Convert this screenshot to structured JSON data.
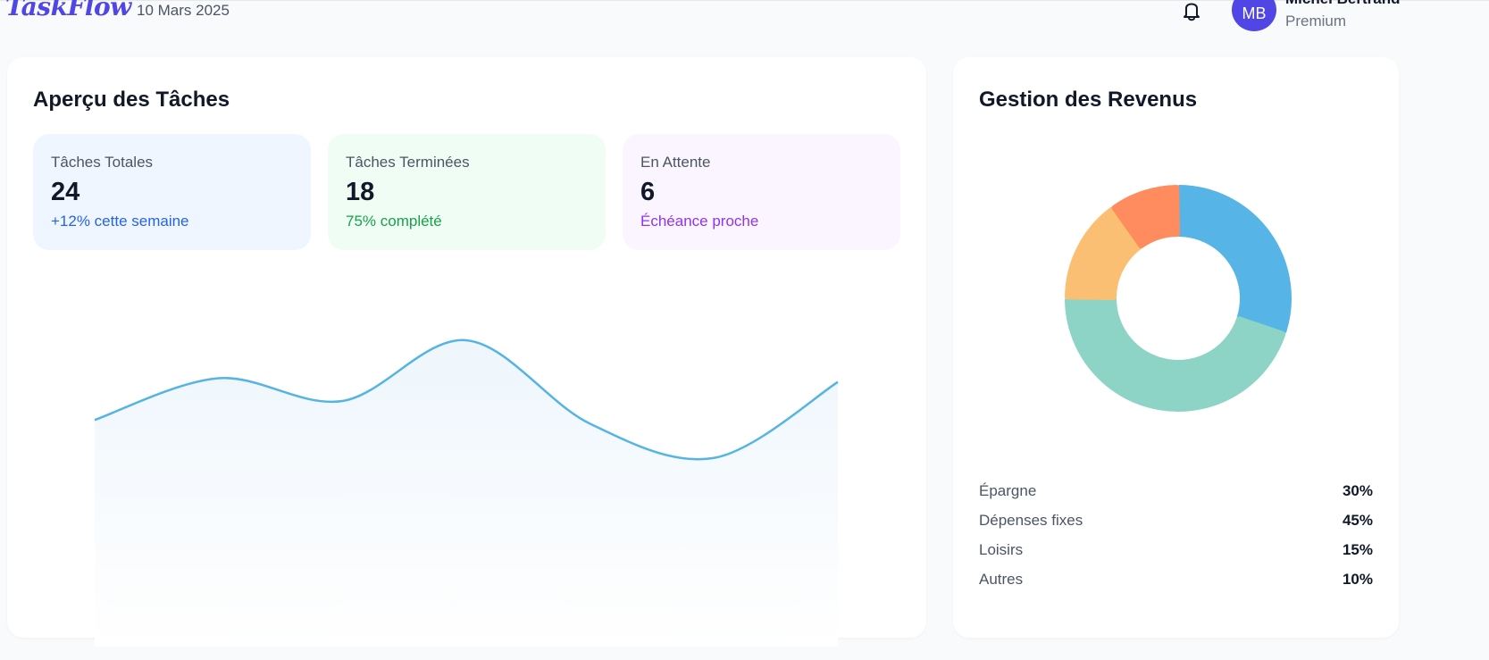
{
  "header": {
    "logo": "TaskFlow",
    "date": "10 Mars 2025",
    "user": {
      "initials": "MB",
      "name": "Michel Bertrand",
      "plan": "Premium"
    }
  },
  "tasks": {
    "title": "Aperçu des Tâches",
    "stats": [
      {
        "label": "Tâches Totales",
        "value": "24",
        "note": "+12% cette semaine"
      },
      {
        "label": "Tâches Terminées",
        "value": "18",
        "note": "75% complété"
      },
      {
        "label": "En Attente",
        "value": "6",
        "note": "Échéance proche"
      }
    ]
  },
  "revenue": {
    "title": "Gestion des Revenus",
    "items": [
      {
        "label": "Épargne",
        "value": "30%"
      },
      {
        "label": "Dépenses fixes",
        "value": "45%"
      },
      {
        "label": "Loisirs",
        "value": "15%"
      },
      {
        "label": "Autres",
        "value": "10%"
      }
    ]
  },
  "chart_data": [
    {
      "type": "area",
      "title": "",
      "x": [
        1,
        2,
        3,
        4,
        5,
        6,
        7
      ],
      "series": [
        {
          "values": [
            30,
            52,
            40,
            72,
            28,
            10,
            50
          ]
        }
      ],
      "colors": {
        "line": "#56b4e3",
        "fill": "#eef6fc"
      }
    },
    {
      "type": "pie",
      "title": "",
      "categories": [
        "Épargne",
        "Dépenses fixes",
        "Loisirs",
        "Autres"
      ],
      "values": [
        30,
        45,
        15,
        10
      ],
      "colors": [
        "#56b4e6",
        "#8ed4c6",
        "#fbbf74",
        "#ff8c5e"
      ]
    }
  ]
}
